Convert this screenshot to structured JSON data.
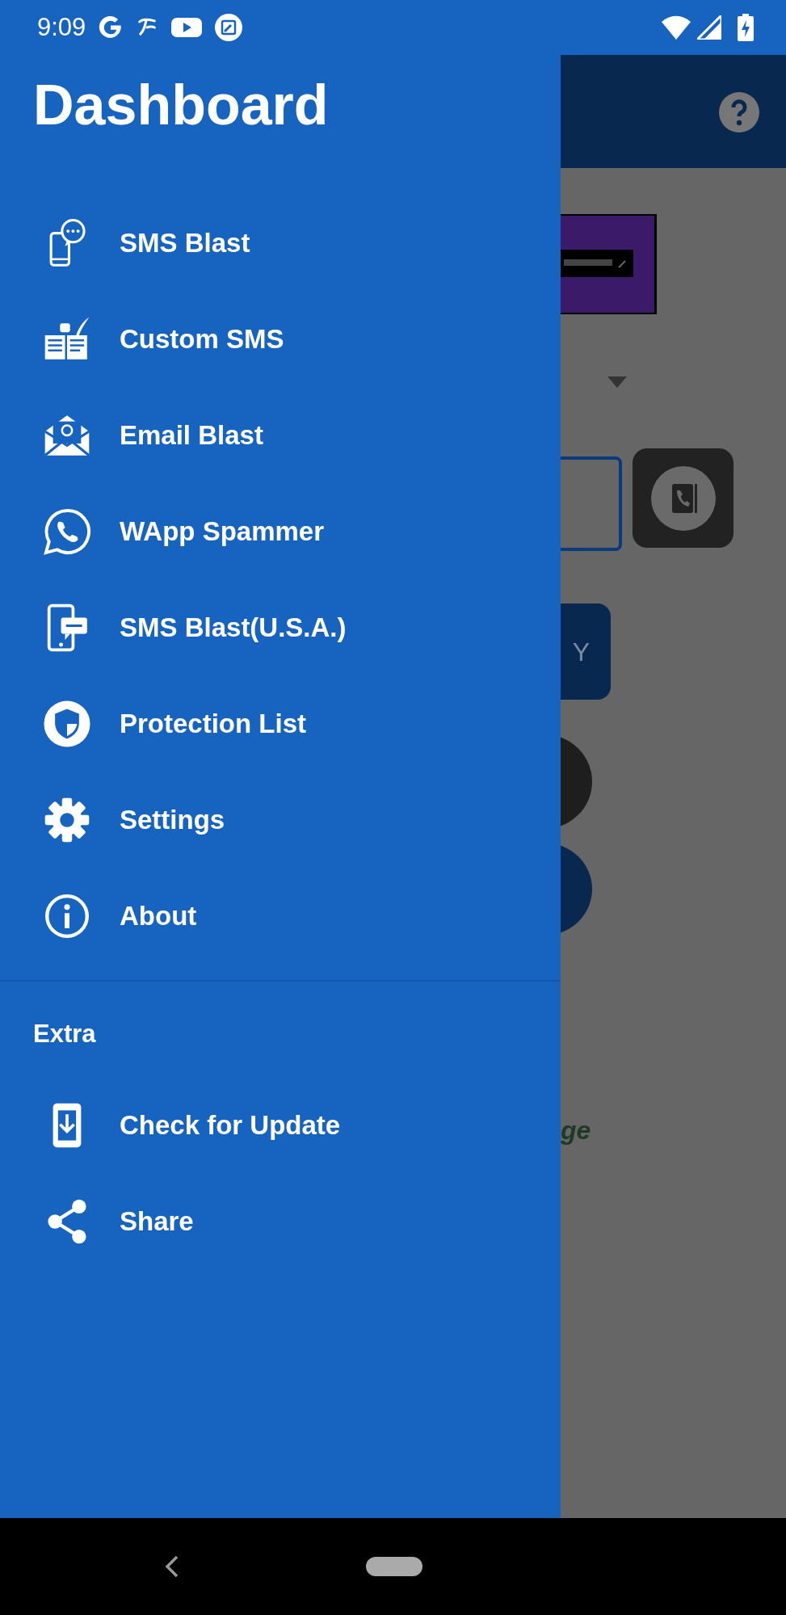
{
  "status_bar": {
    "time": "9:09"
  },
  "drawer": {
    "title": "Dashboard",
    "items": [
      {
        "label": "SMS Blast"
      },
      {
        "label": "Custom SMS"
      },
      {
        "label": "Email Blast"
      },
      {
        "label": "WApp Spammer"
      },
      {
        "label": "SMS Blast(U.S.A.)"
      },
      {
        "label": "Protection List"
      },
      {
        "label": "Settings"
      },
      {
        "label": "About"
      }
    ],
    "section": {
      "title": "Extra",
      "items": [
        {
          "label": "Check for Update"
        },
        {
          "label": "Share"
        }
      ]
    }
  },
  "background": {
    "button_text": "Y",
    "caption": "ge"
  }
}
